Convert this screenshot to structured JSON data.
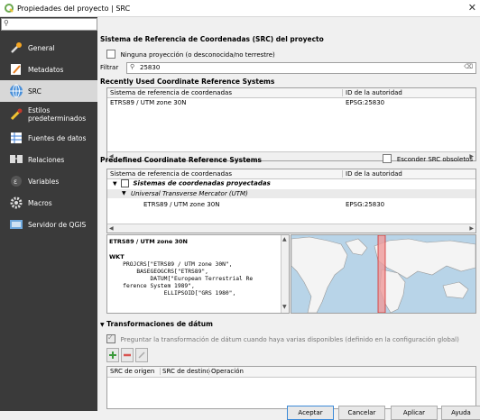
{
  "window": {
    "title": "Propiedades del proyecto | SRC"
  },
  "sidebar": {
    "items": [
      {
        "label": "General",
        "icon": "wrench-icon"
      },
      {
        "label": "Metadatos",
        "icon": "metadata-icon"
      },
      {
        "label": "SRC",
        "icon": "globe-icon",
        "selected": true
      },
      {
        "label": "Estilos predeterminados",
        "icon": "brush-icon"
      },
      {
        "label": "Fuentes de datos",
        "icon": "table-icon"
      },
      {
        "label": "Relaciones",
        "icon": "relations-icon"
      },
      {
        "label": "Variables",
        "icon": "variables-icon"
      },
      {
        "label": "Macros",
        "icon": "gear-icon"
      },
      {
        "label": "Servidor de QGIS",
        "icon": "server-icon"
      }
    ]
  },
  "main": {
    "heading": "Sistema de Referencia de Coordenadas (SRC) del proyecto",
    "no_projection_label": "Ninguna proyección (o desconocida/no terrestre)",
    "filter_label": "Filtrar",
    "filter_value": "25830",
    "recent": {
      "title": "Recently Used Coordinate Reference Systems",
      "col1": "Sistema de referencia de coordenadas",
      "col2": "ID de la autoridad",
      "rows": [
        {
          "name": "ETRS89 / UTM zone 30N",
          "id": "EPSG:25830"
        }
      ]
    },
    "predefined": {
      "title": "Predefined Coordinate Reference Systems",
      "hide_label": "Esconder SRC obsoletos",
      "col1": "Sistema de referencia de coordenadas",
      "col2": "ID de la autoridad",
      "group": "Sistemas de coordenadas proyectadas",
      "subgroup": "Universal Transverse Mercator (UTM)",
      "item": {
        "name": "ETRS89 / UTM zone 30N",
        "id": "EPSG:25830"
      }
    },
    "details": {
      "name": "ETRS89 / UTM zone 30N",
      "wkt_label": "WKT",
      "wkt_text": "    PROJCRS[\"ETRS89 / UTM zone 30N\",\n        BASEGEOGCRS[\"ETRS89\",\n            DATUM[\"European Terrestrial Re\n    ference System 1989\",\n                ELLIPSOID[\"GRS 1980\","
    },
    "datum": {
      "title": "Transformaciones de dátum",
      "ask_label": "Preguntar la transformación de dátum cuando haya varias disponibles (definido en la configuración global)",
      "col_source": "SRC de origen",
      "col_dest": "SRC de destino",
      "col_op": "Operación"
    }
  },
  "buttons": {
    "accept": "Aceptar",
    "cancel": "Cancelar",
    "apply": "Aplicar",
    "help": "Ayuda"
  },
  "colors": {
    "sidebar": "#3a3a3a",
    "highlight": "#ef9a9a",
    "sea": "#b8d4e8"
  }
}
